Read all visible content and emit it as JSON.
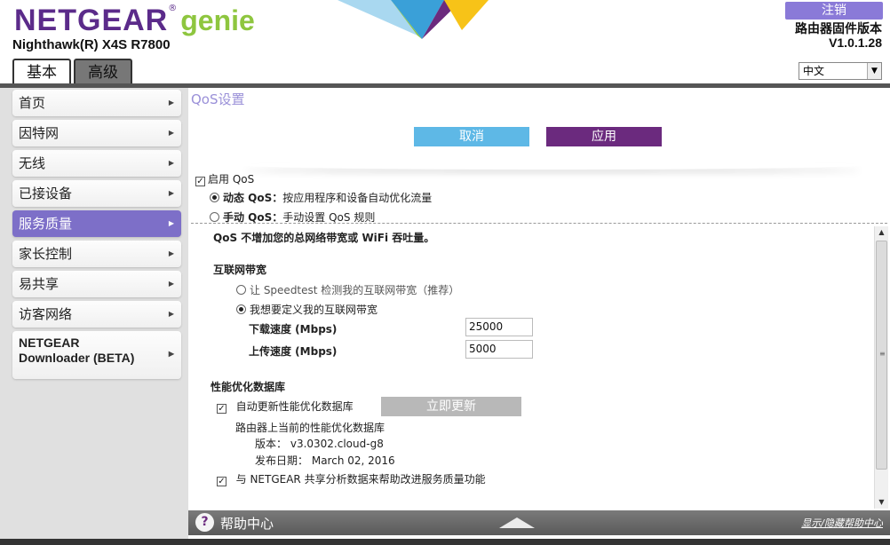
{
  "header": {
    "brand": "NETGEAR",
    "brand_mark": "®",
    "product": "genie",
    "model": "Nighthawk(R) X4S R7800",
    "logout_label": "注销",
    "firmware_label": "路由器固件版本",
    "firmware_version": "V1.0.1.28",
    "language": "中文"
  },
  "tabs": [
    {
      "label": "基本",
      "active": true
    },
    {
      "label": "高级",
      "active": false
    }
  ],
  "sidebar": {
    "items": [
      {
        "label": "首页"
      },
      {
        "label": "因特网"
      },
      {
        "label": "无线"
      },
      {
        "label": "已接设备"
      },
      {
        "label": "服务质量",
        "active": true
      },
      {
        "label": "家长控制"
      },
      {
        "label": "易共享"
      },
      {
        "label": "访客网络"
      },
      {
        "label_line1": "NETGEAR",
        "label_line2": "Downloader (BETA)"
      }
    ]
  },
  "main": {
    "title": "QoS设置",
    "cancel_label": "取消",
    "apply_label": "应用",
    "enable_qos": {
      "label": "启用 QoS",
      "checked": true
    },
    "dynamic_qos": {
      "label_bold": "动态 QoS：",
      "label": "按应用程序和设备自动优化流量",
      "selected": true
    },
    "manual_qos": {
      "label_bold": "手动 QoS：",
      "label": "手动设置 QoS 规则",
      "selected": false
    },
    "note": "QoS 不增加您的总网络带宽或 WiFi 吞吐量。",
    "bandwidth": {
      "heading": "互联网带宽",
      "speedtest_option": "让 Speedtest 检测我的互联网带宽（推荐）",
      "custom_option": "我想要定义我的互联网带宽",
      "download_label": "下载速度 (Mbps)",
      "download_value": "25000",
      "upload_label": "上传速度 (Mbps)",
      "upload_value": "5000"
    },
    "database": {
      "heading": "性能优化数据库",
      "auto_update_label": "自动更新性能优化数据库",
      "update_now_label": "立即更新",
      "current_label": "路由器上当前的性能优化数据库",
      "version_label": "版本：",
      "version_value": "v3.0302.cloud-g8",
      "date_label": "发布日期：",
      "date_value": "March 02, 2016",
      "share_label": "与 NETGEAR 共享分析数据来帮助改进服务质量功能"
    }
  },
  "helpbar": {
    "label": "帮助中心",
    "toggle_label": "显示/隐藏帮助中心"
  },
  "colors": {
    "brand_purple": "#5b2b8a",
    "genie_green": "#8ec63f",
    "active_nav": "#7d6fc8",
    "cancel_blue": "#5eb8e6",
    "apply_purple": "#6b2a7e"
  }
}
